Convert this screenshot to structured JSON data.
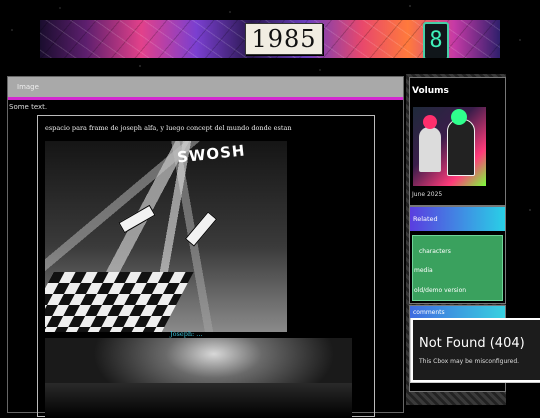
{
  "banner": {
    "year": "1985",
    "icon_digit": "8"
  },
  "main": {
    "title": "Image",
    "intro_text": "Some text.",
    "caption": "espacio para frame de joseph alfa, y luego concept del mundo donde estan",
    "sfx_text": "SWOSH",
    "dialog_text": "Joseph: ..."
  },
  "sidebar": {
    "volumes": {
      "heading": "Volums",
      "date": "June 2025"
    },
    "related": {
      "heading": "Related",
      "links": [
        "characters",
        "media",
        "old/demo version"
      ]
    },
    "comments": {
      "heading": "comments"
    }
  },
  "error_popup": {
    "title": "Not Found (404)",
    "message": "This Cbox may be misconfigured."
  },
  "colors": {
    "accent_magenta": "#d428d0",
    "related_green": "#3aa15e",
    "dialog_cyan": "#39c3d9"
  }
}
